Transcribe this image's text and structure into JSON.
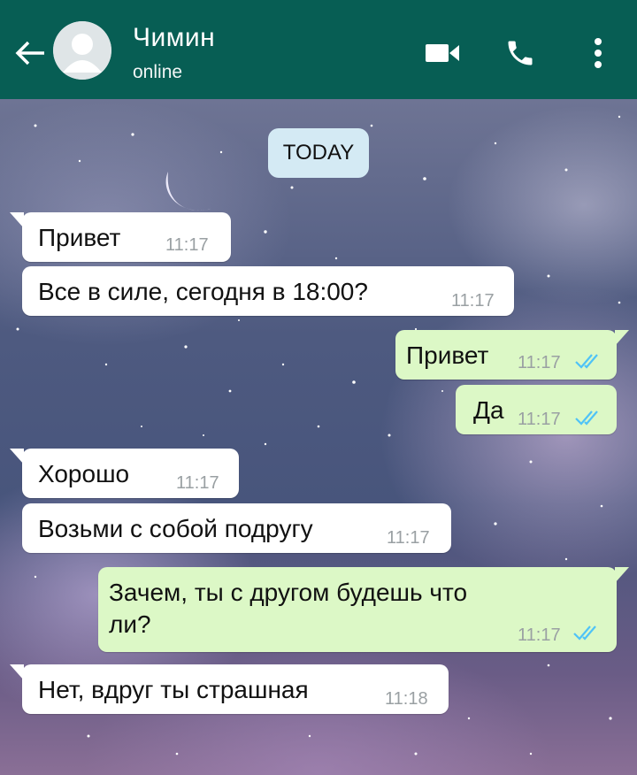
{
  "header": {
    "contact_name": "Чимин",
    "status": "online",
    "background": "#075e54"
  },
  "chat": {
    "date_label": "TODAY",
    "messages": [
      {
        "dir": "in",
        "text": "Привет",
        "time": "11:17"
      },
      {
        "dir": "in",
        "text": "Все в силе, сегодня в 18:00?",
        "time": "11:17"
      },
      {
        "dir": "out",
        "text": "Привет",
        "time": "11:17",
        "read": true
      },
      {
        "dir": "out",
        "text": "Да",
        "time": "11:17",
        "read": true
      },
      {
        "dir": "in",
        "text": "Хорошо",
        "time": "11:17"
      },
      {
        "dir": "in",
        "text": "Возьми с собой подругу",
        "time": "11:17"
      },
      {
        "dir": "out",
        "text_line1": "Зачем, ты с другом будешь что",
        "text_line2": "ли?",
        "time": "11:17",
        "read": true
      },
      {
        "dir": "in",
        "text": "Нет, вдруг ты страшная",
        "time": "11:18"
      }
    ]
  },
  "icons": {
    "back": "arrow-left-icon",
    "avatar": "default-avatar-icon",
    "video": "video-camera-icon",
    "call": "phone-icon",
    "menu": "more-vert-icon",
    "read_receipt": "double-check-icon"
  },
  "colors": {
    "incoming_bubble": "#ffffff",
    "outgoing_bubble": "#dcf8c6",
    "date_chip": "#d4eaf4",
    "read_ticks": "#4fc3f7"
  }
}
